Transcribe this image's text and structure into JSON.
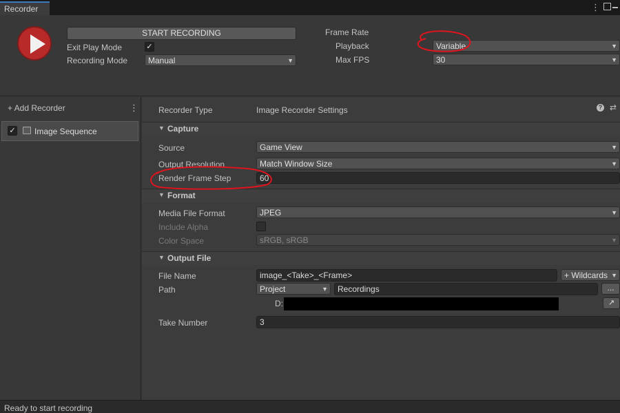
{
  "window": {
    "tab_label": "Recorder",
    "menu_icon": "kebab-menu-icon",
    "max_icon": "maximize-icon",
    "close_icon": "close-icon"
  },
  "top": {
    "start_button": "START RECORDING",
    "exit_play_mode_label": "Exit Play Mode",
    "exit_play_mode_checked": true,
    "recording_mode_label": "Recording Mode",
    "recording_mode_value": "Manual",
    "frame_rate_label": "Frame Rate",
    "playback_label": "Playback",
    "playback_value": "Variable",
    "max_fps_label": "Max FPS",
    "max_fps_value": "30"
  },
  "left": {
    "add_recorder_label": "+ Add Recorder",
    "items": [
      {
        "label": "Image Sequence",
        "checked": true,
        "icon": "image-icon"
      }
    ]
  },
  "settings": {
    "recorder_type_label": "Recorder Type",
    "recorder_type_value": "Image Recorder Settings",
    "capture": {
      "title": "Capture",
      "source_label": "Source",
      "source_value": "Game View",
      "output_resolution_label": "Output Resolution",
      "output_resolution_value": "Match Window Size",
      "render_frame_step_label": "Render Frame Step",
      "render_frame_step_value": "60"
    },
    "format": {
      "title": "Format",
      "media_file_format_label": "Media File Format",
      "media_file_format_value": "JPEG",
      "include_alpha_label": "Include Alpha",
      "color_space_label": "Color Space",
      "color_space_value": "sRGB, sRGB"
    },
    "output_file": {
      "title": "Output File",
      "file_name_label": "File Name",
      "file_name_value": "image_<Take>_<Frame>",
      "wildcards_button": "+ Wildcards",
      "path_label": "Path",
      "path_root_value": "Project",
      "path_folder_value": "Recordings",
      "browse_button": "...",
      "full_path_prefix": "D:",
      "take_number_label": "Take Number",
      "take_number_value": "3"
    }
  },
  "status": {
    "text": "Ready to start recording"
  },
  "colors": {
    "record_button": "#b82a2a",
    "annotation": "#e0141e",
    "tab_accent": "#3a79bb"
  }
}
